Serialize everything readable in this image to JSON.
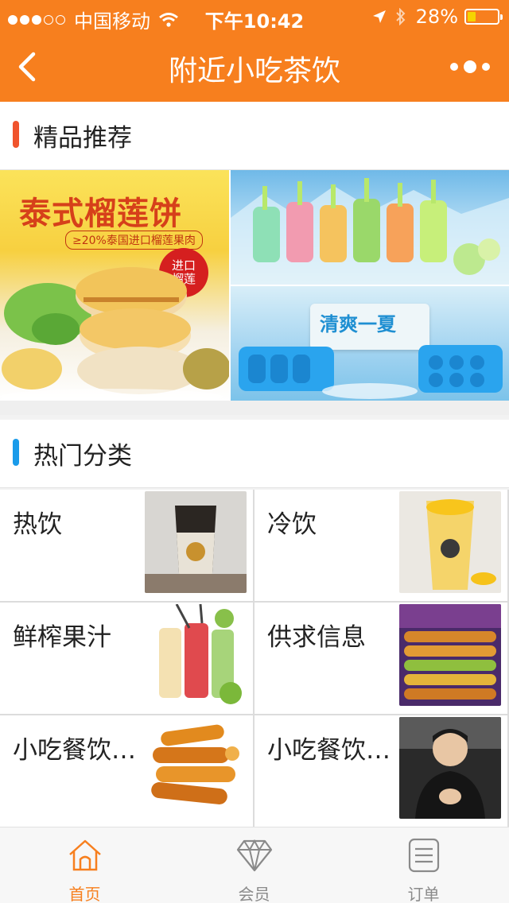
{
  "status_bar": {
    "carrier": "中国移动",
    "time": "下午10:42",
    "battery": "28%",
    "battery_level": 0.28
  },
  "nav": {
    "title": "附近小吃茶饮",
    "back_icon": "chevron-left-icon",
    "more_icon": "more-dots-icon"
  },
  "featured": {
    "title": "精品推荐",
    "bar_color": "#f0542d",
    "banners": {
      "left_headline": "泰式榴莲饼",
      "left_sub": "≥20%泰国进口榴莲果肉",
      "left_tag": "进口\n榴莲",
      "right_bottom_headline": "清爽一夏"
    }
  },
  "categories": {
    "title": "热门分类",
    "bar_color": "#1a9bea",
    "items": [
      {
        "name": "热饮"
      },
      {
        "name": "冷饮"
      },
      {
        "name": "鲜榨果汁"
      },
      {
        "name": "供求信息"
      },
      {
        "name": "小吃餐饮…"
      },
      {
        "name": "小吃餐饮…"
      }
    ]
  },
  "tabbar": {
    "items": [
      {
        "label": "首页",
        "icon": "home-icon",
        "active": true
      },
      {
        "label": "会员",
        "icon": "diamond-icon",
        "active": false
      },
      {
        "label": "订单",
        "icon": "list-document-icon",
        "active": false
      }
    ]
  },
  "colors": {
    "accent": "#f77f1e",
    "tab_active": "#f77f1e",
    "tab_inactive": "#8a8a8a"
  }
}
